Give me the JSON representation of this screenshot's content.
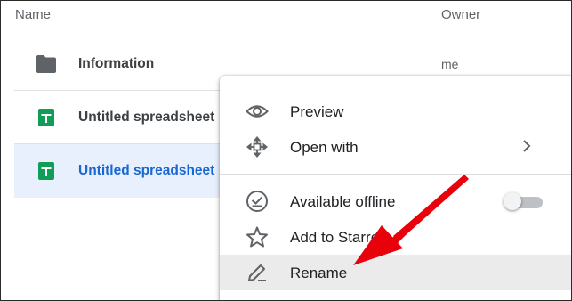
{
  "header": {
    "name_label": "Name",
    "owner_label": "Owner"
  },
  "files": [
    {
      "name": "Information",
      "owner": "me",
      "icon": "folder-icon"
    },
    {
      "name": "Untitled spreadsheet",
      "owner": "",
      "icon": "sheets-icon"
    },
    {
      "name": "Untitled spreadsheet",
      "owner": "",
      "icon": "sheets-icon",
      "selected": true
    }
  ],
  "menu": {
    "items": [
      {
        "label": "Preview",
        "icon": "eye-icon"
      },
      {
        "label": "Open with",
        "icon": "move-arrows-icon",
        "submenu": true
      },
      {
        "label": "Available offline",
        "icon": "offline-check-icon",
        "toggle": false
      },
      {
        "label": "Add to Starred",
        "icon": "star-icon"
      },
      {
        "label": "Rename",
        "icon": "pencil-icon",
        "hovered": true
      }
    ]
  },
  "colors": {
    "selected_row_bg": "#e8f0fe",
    "selected_text": "#1967d2",
    "sheets_green": "#0f9d58",
    "folder_gray": "#5f6368",
    "arrow_red": "#e8000b",
    "hover_bg": "#ebebeb"
  }
}
